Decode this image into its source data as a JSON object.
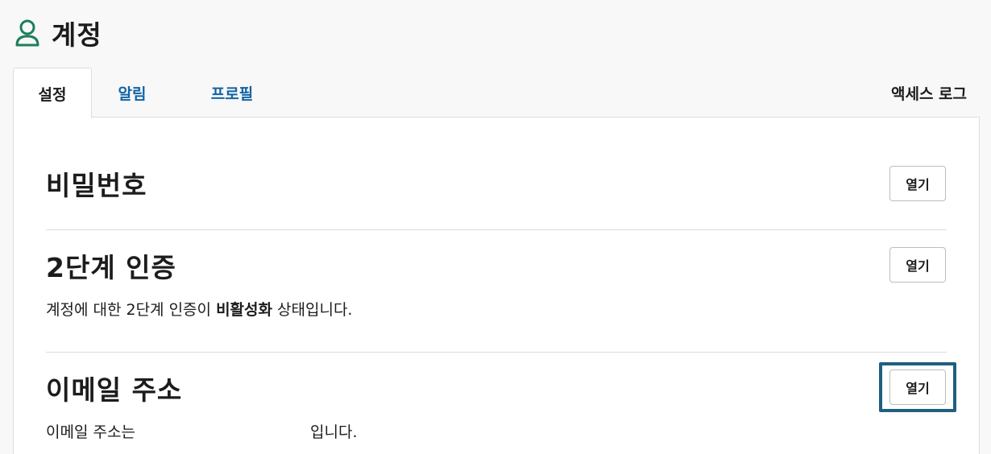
{
  "header": {
    "title": "계정",
    "icon": "user-icon",
    "icon_color": "#1a7f5a"
  },
  "tabs": {
    "items": [
      {
        "label": "설정"
      },
      {
        "label": "알림"
      },
      {
        "label": "프로필"
      }
    ],
    "right_link": "액세스 로그"
  },
  "sections": [
    {
      "title": "비밀번호",
      "button": "열기"
    },
    {
      "title": "2단계 인증",
      "button": "열기",
      "desc_before": "계정에 대한 2단계 인증이 ",
      "desc_bold": "비활성화",
      "desc_after": " 상태입니다."
    },
    {
      "title": "이메일 주소",
      "button": "열기",
      "desc_before": "이메일 주소는",
      "desc_after": "입니다."
    }
  ],
  "colors": {
    "link": "#1264a3",
    "focus": "#1f5f80",
    "text": "#1d1c1d"
  }
}
